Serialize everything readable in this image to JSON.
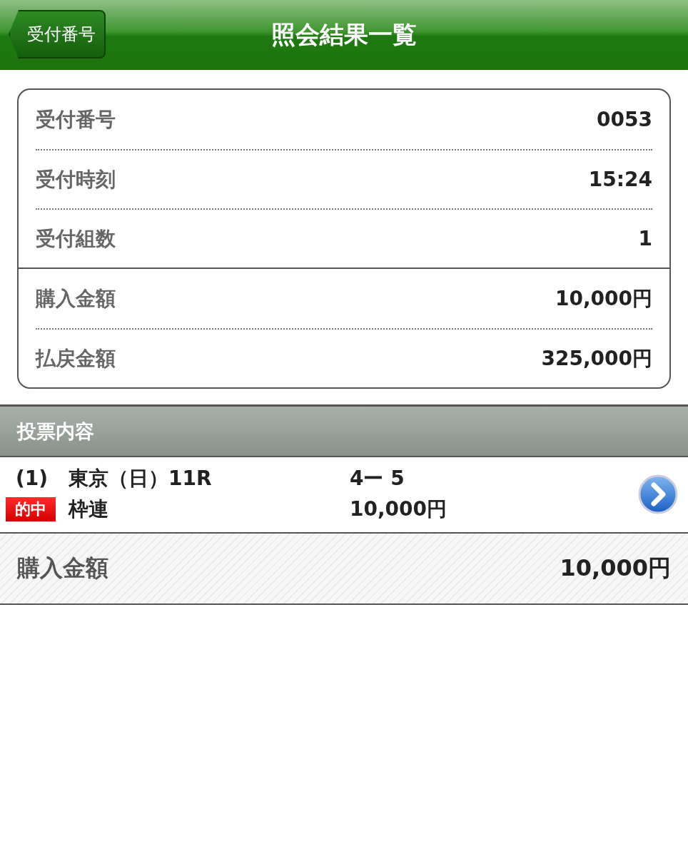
{
  "header": {
    "back_button": "受付番号",
    "title": "照会結果一覧"
  },
  "summary": {
    "groups": [
      {
        "rows": [
          {
            "label": "受付番号",
            "value": "0053"
          },
          {
            "label": "受付時刻",
            "value": "15:24"
          },
          {
            "label": "受付組数",
            "value": "1"
          }
        ]
      },
      {
        "rows": [
          {
            "label": "購入金額",
            "value": "10,000円"
          },
          {
            "label": "払戻金額",
            "value": "325,000円"
          }
        ]
      }
    ]
  },
  "section": {
    "title": "投票内容"
  },
  "bets": [
    {
      "number": "(1)",
      "badge": "的中",
      "race": "東京（日）11R",
      "bet_type": "枠連",
      "combination": "4ー 5",
      "amount": "10,000円"
    }
  ],
  "total": {
    "label": "購入金額",
    "value": "10,000円"
  }
}
